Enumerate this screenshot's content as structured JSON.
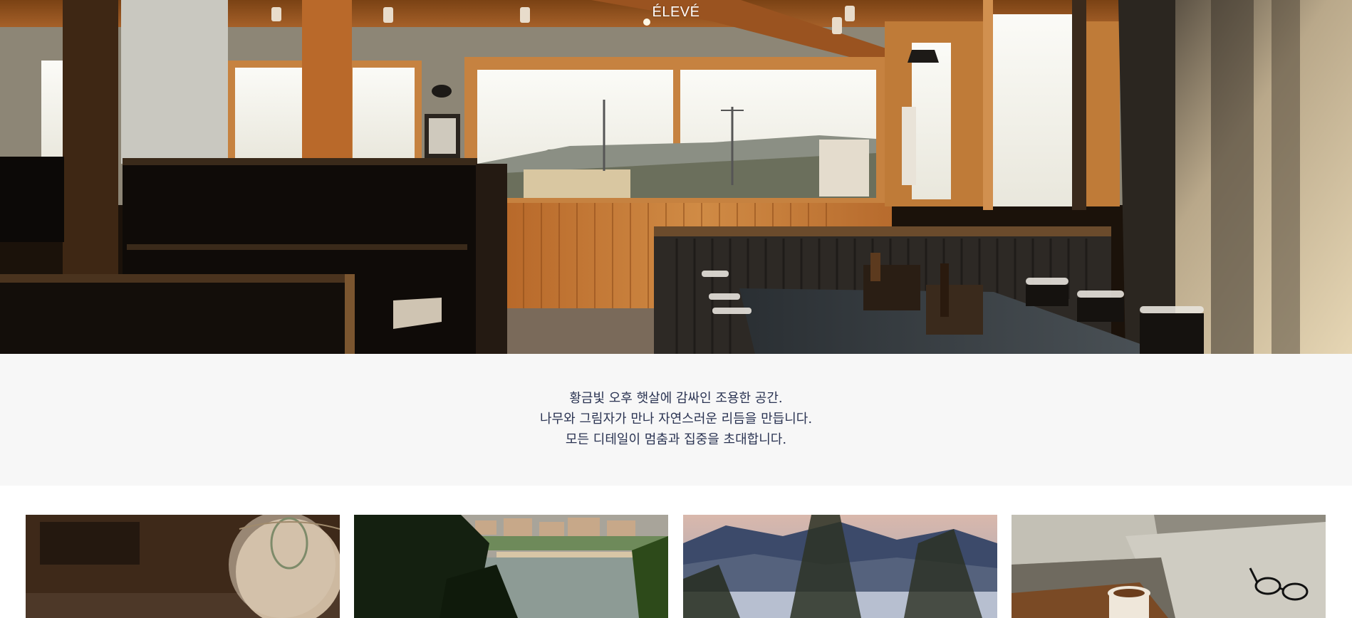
{
  "brand": {
    "name": "ÉLEVÉ"
  },
  "hero": {
    "image_alt": "Sunlit diner interior with wooden walls, booths, large windows and a table with chairs",
    "colors": {
      "wood": "#c27a34",
      "shadow": "#140d08",
      "sky": "#f2f2ee"
    }
  },
  "intro": {
    "lines": [
      "황금빛 오후 햇살에 감싸인 조용한 공간.",
      "나무와 그림자가 만나 자연스러운 리듬을 만듭니다.",
      "모든 디테일이 멈춤과 집중을 초대합니다."
    ],
    "text_color": "#2a3352",
    "background": "#f7f7f7"
  },
  "gallery": {
    "items": [
      {
        "name": "globe-photo",
        "alt": "Vintage globe in a dim room"
      },
      {
        "name": "river-town-photo",
        "alt": "Riverside town seen through trees"
      },
      {
        "name": "mountain-lake-photo",
        "alt": "Blurred mountains and lake at dusk"
      },
      {
        "name": "coffee-glasses-photo",
        "alt": "Coffee cup and eyeglasses on a bed"
      }
    ]
  }
}
